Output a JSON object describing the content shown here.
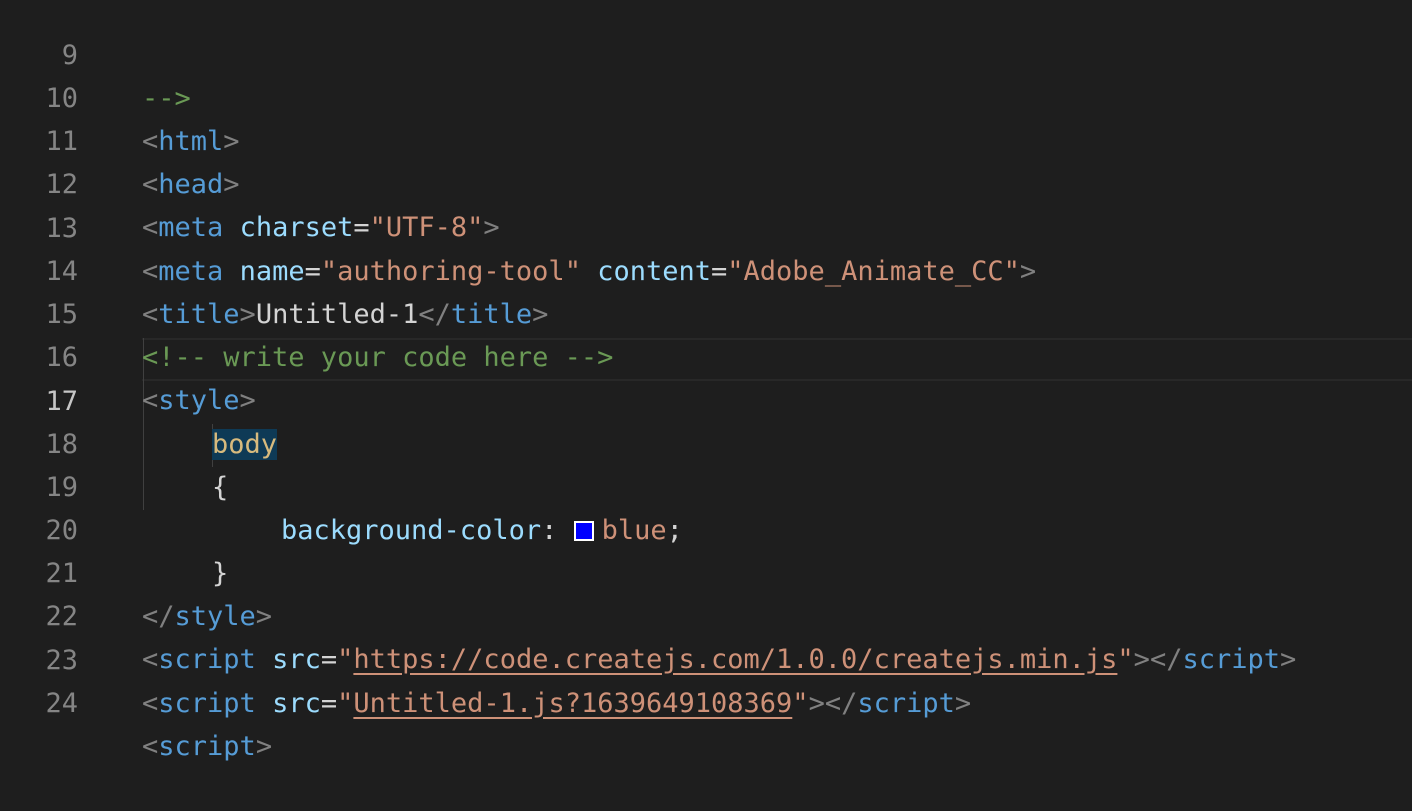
{
  "editor": {
    "line_numbers": [
      "9",
      "10",
      "11",
      "12",
      "13",
      "14",
      "15",
      "16",
      "17",
      "18",
      "19",
      "20",
      "21",
      "22",
      "23",
      "24"
    ],
    "active_line": "17",
    "l9": {
      "comment": "-->"
    },
    "l10": {
      "open": "<",
      "tag": "html",
      "close": ">"
    },
    "l11": {
      "open": "<",
      "tag": "head",
      "close": ">"
    },
    "l12": {
      "open": "<",
      "tag": "meta",
      "attr": "charset",
      "eq": "=",
      "value": "\"UTF-8\"",
      "close": ">"
    },
    "l13": {
      "open": "<",
      "tag": "meta",
      "attr1": "name",
      "eq1": "=",
      "value1": "\"authoring-tool\"",
      "attr2": "content",
      "eq2": "=",
      "value2": "\"Adobe_Animate_CC\"",
      "close": ">"
    },
    "l14": {
      "open": "<",
      "tag": "title",
      "close": ">",
      "text": "Untitled-1",
      "end_open": "</",
      "end_tag": "title",
      "end_close": ">"
    },
    "l15": {
      "comment": "<!-- write your code here -->"
    },
    "l16": {
      "open": "<",
      "tag": "style",
      "close": ">"
    },
    "l17": {
      "selector": "body"
    },
    "l18": {
      "brace": "{"
    },
    "l19": {
      "property": "background-color",
      "colon": ":",
      "value": "blue",
      "semi": ";",
      "swatch_color": "#0000ff"
    },
    "l20": {
      "brace": "}"
    },
    "l21": {
      "open": "</",
      "tag": "style",
      "close": ">"
    },
    "l22": {
      "open": "<",
      "tag": "script",
      "attr": "src",
      "eq": "=",
      "q1": "\"",
      "url": "https://code.createjs.com/1.0.0/createjs.min.js",
      "q2": "\"",
      "close": ">",
      "end_open": "</",
      "end_tag": "script",
      "end_close": ">"
    },
    "l23": {
      "open": "<",
      "tag": "script",
      "attr": "src",
      "eq": "=",
      "q1": "\"",
      "url": "Untitled-1.js?1639649108369",
      "q2": "\"",
      "close": ">",
      "end_open": "</",
      "end_tag": "script",
      "end_close": ">"
    },
    "l24": {
      "open": "<",
      "tag": "script",
      "close": ">"
    }
  },
  "colors": {
    "background": "#1e1e1e",
    "tag": "#569cd6",
    "attribute": "#9cdcfe",
    "string": "#ce9178",
    "comment": "#6a9955",
    "selector": "#d7ba7d"
  }
}
